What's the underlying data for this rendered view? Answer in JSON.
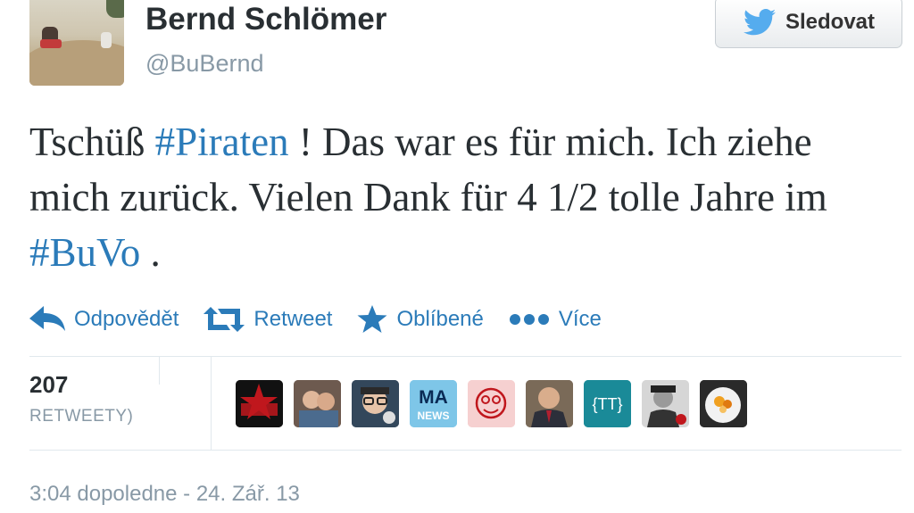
{
  "profile": {
    "display_name": "Bernd Schlömer",
    "username": "@BuBernd",
    "avatar_icon": "profile-photo"
  },
  "follow_button": {
    "label": "Sledovat",
    "icon": "twitter-bird-icon",
    "icon_color": "#55acee"
  },
  "tweet": {
    "part1": "Tschüß ",
    "hashtag1": "#Piraten",
    "part2": " ! Das war es für mich. Ich ziehe mich zurück. Vielen Dank für 4 1/2 tolle Jahre im ",
    "hashtag2": "#BuVo",
    "part3": " ."
  },
  "actions": [
    {
      "label": "Odpovědět",
      "icon": "reply-icon"
    },
    {
      "label": "Retweet",
      "icon": "retweet-icon"
    },
    {
      "label": "Oblíbené",
      "icon": "star-icon"
    },
    {
      "label": "Více",
      "icon": "more-dots-icon"
    }
  ],
  "stats": {
    "count": "207",
    "label": "RETWEETY)"
  },
  "retweeter_avatars": [
    "avatar-1",
    "avatar-2",
    "avatar-3",
    "avatar-4",
    "avatar-5",
    "avatar-6",
    "avatar-7",
    "avatar-8",
    "avatar-9"
  ],
  "retweeter_avatar_texts": {
    "a4_top": "MA",
    "a4_bottom": "NEWS",
    "a7": "{TT}"
  },
  "timestamp": "3:04 dopoledne - 24. Zář. 13",
  "colors": {
    "link": "#2b7bb9",
    "muted": "#8899a6",
    "text": "#292f33"
  }
}
